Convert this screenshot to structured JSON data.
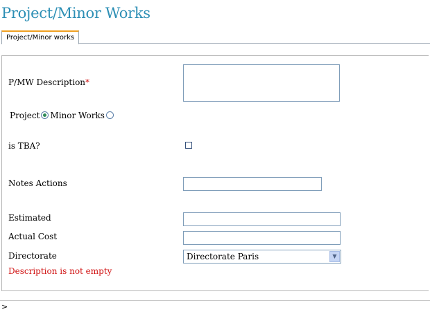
{
  "page": {
    "title": "Project/Minor Works"
  },
  "tabs": [
    {
      "label": "Project/Minor works",
      "active": true
    }
  ],
  "form": {
    "description_label": "P/MW Description",
    "required_marker": "*",
    "description_value": "",
    "type_options": {
      "project_label": "Project",
      "minor_works_label": "Minor Works",
      "selected": "Project"
    },
    "tba_label": "is TBA?",
    "tba_checked": false,
    "notes_label": "Notes Actions",
    "notes_value": "",
    "estimated_label": "Estimated",
    "estimated_value": "",
    "actual_cost_label": "Actual Cost",
    "actual_cost_value": "",
    "directorate_label": "Directorate",
    "directorate_selected": "Directorate Paris",
    "error_message": "Description is not empty"
  },
  "footer": {
    "prompt": ">"
  },
  "colors": {
    "title": "#2d8fb5",
    "tab_accent": "#f0a020",
    "error": "#d01010"
  }
}
